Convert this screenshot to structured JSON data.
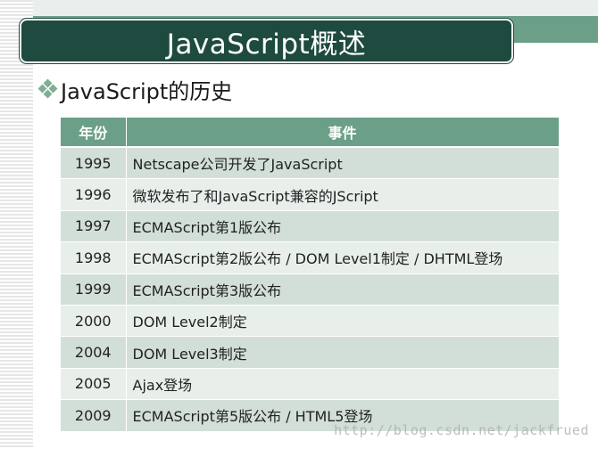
{
  "slide": {
    "title": "JavaScript概述",
    "subtitle": "JavaScript的历史",
    "bullet_icon": "diamond-cluster-icon",
    "colors": {
      "header_green": "#6c9f87",
      "title_dark": "#1e4a40",
      "row_dark": "#d2dfd8",
      "row_light": "#e8efeb"
    }
  },
  "table": {
    "headers": [
      "年份",
      "事件"
    ],
    "rows": [
      {
        "year": "1995",
        "event": "Netscape公司开发了JavaScript"
      },
      {
        "year": "1996",
        "event": "微软发布了和JavaScript兼容的JScript"
      },
      {
        "year": "1997",
        "event": "ECMAScript第1版公布"
      },
      {
        "year": "1998",
        "event": "ECMAScript第2版公布 / DOM Level1制定 / DHTML登场"
      },
      {
        "year": "1999",
        "event": "ECMAScript第3版公布"
      },
      {
        "year": "2000",
        "event": "DOM Level2制定"
      },
      {
        "year": "2004",
        "event": "DOM Level3制定"
      },
      {
        "year": "2005",
        "event": "Ajax登场"
      },
      {
        "year": "2009",
        "event": "ECMAScript第5版公布 / HTML5登场"
      }
    ]
  },
  "watermark": "http://blog.csdn.net/jackfrued"
}
